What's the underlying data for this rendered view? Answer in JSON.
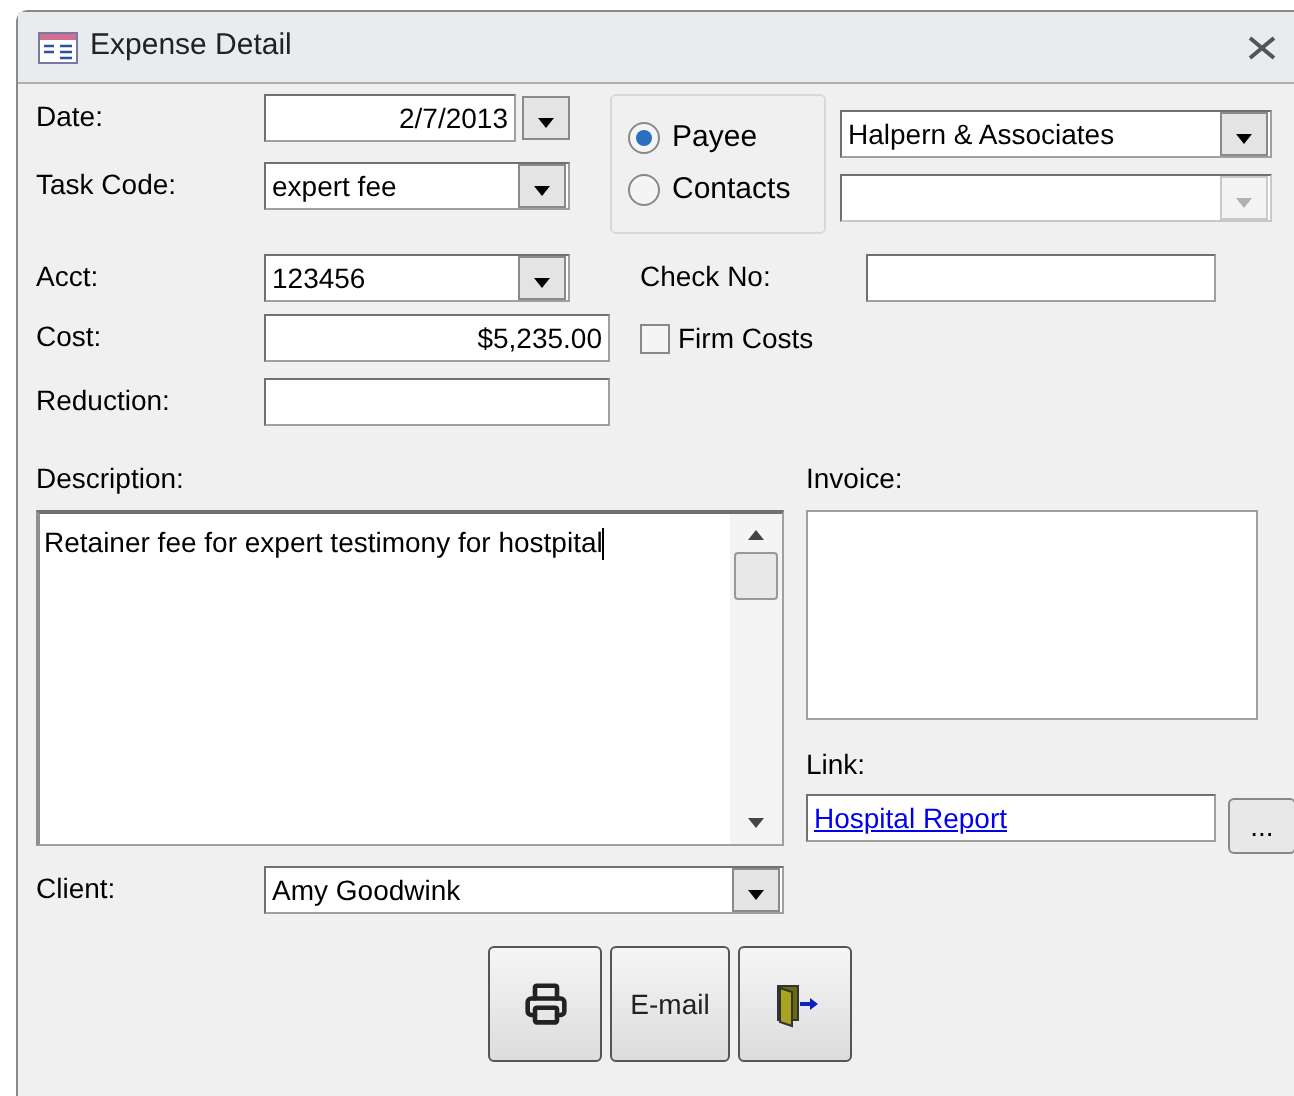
{
  "window": {
    "title": "Expense Detail"
  },
  "date": {
    "label": "Date:",
    "value": "2/7/2013"
  },
  "task_code": {
    "label": "Task Code:",
    "value": "expert fee"
  },
  "payee_options": [
    {
      "label": "Payee",
      "selected": true
    },
    {
      "label": "Contacts",
      "selected": false
    }
  ],
  "payee": {
    "value": "Halpern & Associates",
    "disabled": false
  },
  "contact": {
    "disabled": true
  },
  "acct": {
    "label": "Acct:",
    "value": "123456"
  },
  "check_no": {
    "label": "Check No:"
  },
  "cost": {
    "label": "Cost:",
    "value": "$5,235.00"
  },
  "firm_costs": {
    "label": "Firm Costs",
    "checked": false
  },
  "reduction": {
    "label": "Reduction:"
  },
  "description": {
    "label": "Description:",
    "value": "Retainer fee for expert testimony for hostpital"
  },
  "invoice": {
    "label": "Invoice:"
  },
  "link": {
    "label": "Link:",
    "value": "Hospital Report"
  },
  "browse_button": {
    "label": "..."
  },
  "client": {
    "label": "Client:",
    "value": "Amy Goodwink"
  },
  "buttons": [
    {
      "kind": "print"
    },
    {
      "kind": "email",
      "label": "E-mail"
    },
    {
      "kind": "exit"
    }
  ]
}
